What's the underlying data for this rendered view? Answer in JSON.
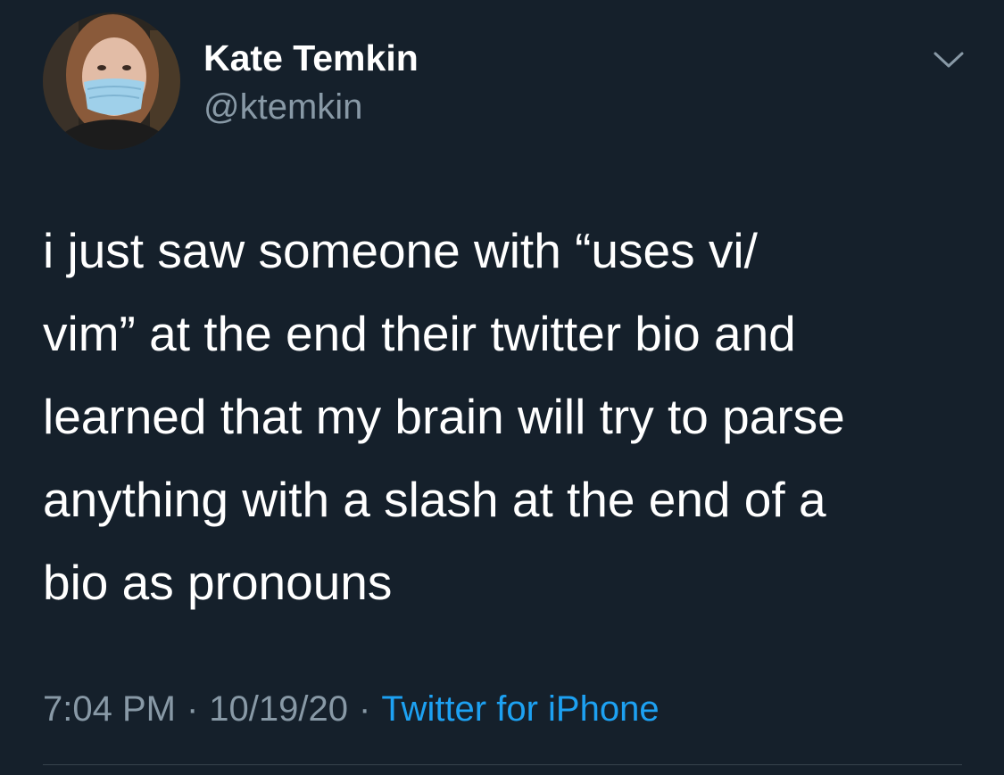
{
  "author": {
    "name": "Kate Temkin",
    "handle": "@ktemkin"
  },
  "tweet": {
    "text": "i just saw someone with “uses vi/\nvim” at the end their twitter bio and\nlearned that my brain will try to parse\nanything with a slash at the end of a\nbio as pronouns"
  },
  "meta": {
    "time": "7:04 PM",
    "separator": "·",
    "date": "10/19/20",
    "source": "Twitter for iPhone"
  },
  "icons": {
    "more": "chevron-down-icon",
    "avatar": "profile-photo"
  },
  "colors": {
    "background": "#15202b",
    "primary_text": "#ffffff",
    "secondary_text": "#8899a6",
    "link": "#1da1f2",
    "divider": "#38444d"
  }
}
